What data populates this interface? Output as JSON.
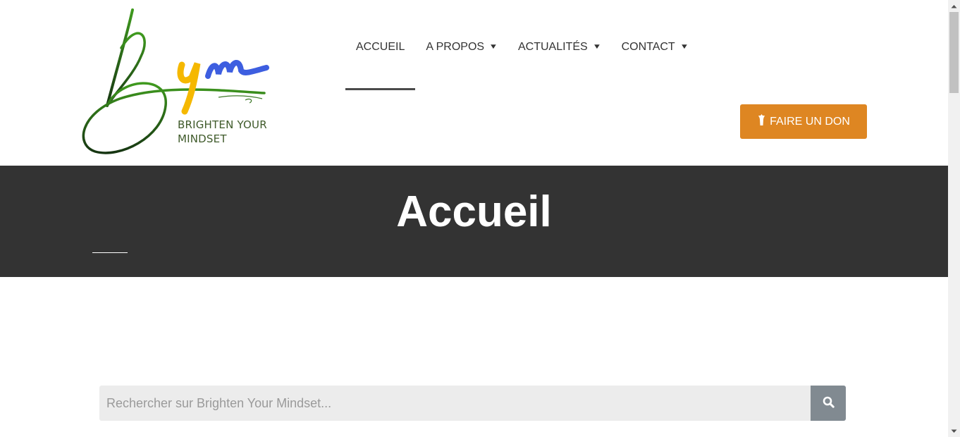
{
  "logo": {
    "line1": "BRIGHTEN YOUR",
    "line2": "MINDSET",
    "colors": {
      "green": "#2e7d1a",
      "yellow": "#f5b800",
      "blue": "#3d5ee0",
      "dark_green": "#1c3d12"
    }
  },
  "nav": {
    "items": [
      {
        "label": "ACCUEIL",
        "has_dropdown": false,
        "active": true
      },
      {
        "label": "A PROPOS",
        "has_dropdown": true,
        "active": false
      },
      {
        "label": "ACTUALITÉS",
        "has_dropdown": true,
        "active": false
      },
      {
        "label": "CONTACT",
        "has_dropdown": true,
        "active": false
      }
    ]
  },
  "donate": {
    "label": "FAIRE UN DON",
    "icon": "donate-icon",
    "color": "#de8622"
  },
  "hero": {
    "title": "Accueil",
    "background": "#333333"
  },
  "search": {
    "placeholder": "Rechercher sur Brighten Your Mindset...",
    "value": "",
    "icon": "search-icon"
  }
}
